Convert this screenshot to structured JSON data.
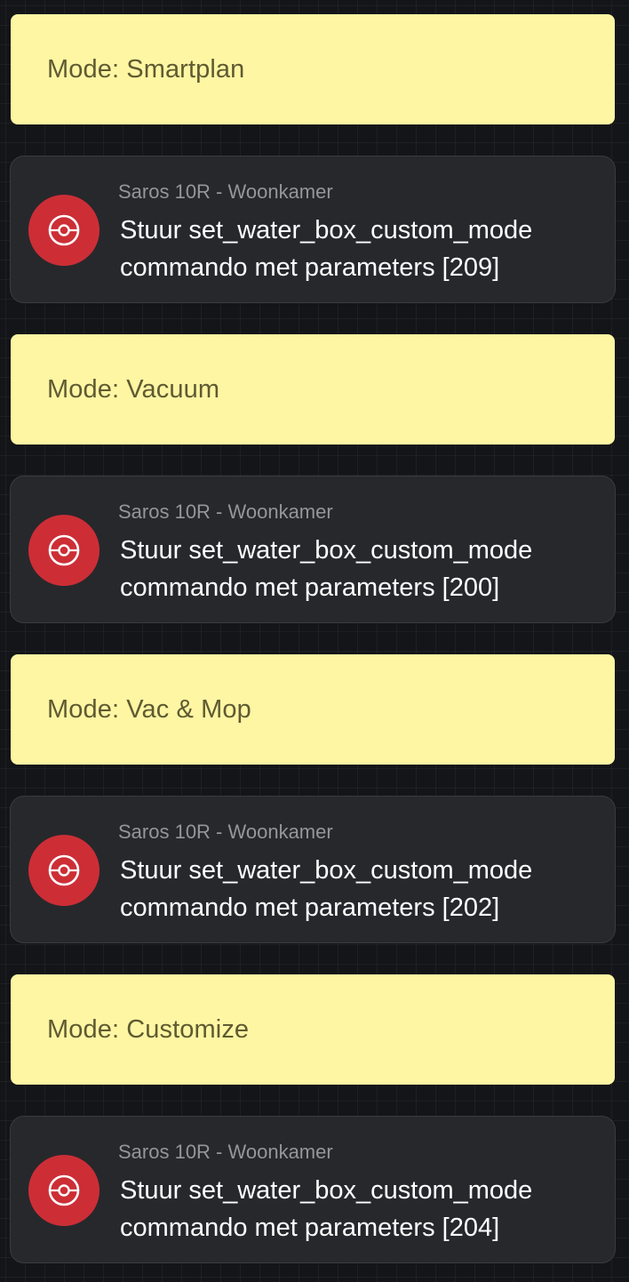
{
  "blocks": [
    {
      "note": {
        "text": "Mode: Smartplan"
      },
      "action": {
        "device": "Saros 10R - Woonkamer",
        "verb": "Stuur",
        "command": "set_water_box_custom_mode",
        "suffix": "commando met parameters",
        "params": "[209]",
        "icon": "robot-vacuum-icon"
      }
    },
    {
      "note": {
        "text": "Mode: Vacuum"
      },
      "action": {
        "device": "Saros 10R - Woonkamer",
        "verb": "Stuur",
        "command": "set_water_box_custom_mode",
        "suffix": "commando met parameters",
        "params": "[200]",
        "icon": "robot-vacuum-icon"
      }
    },
    {
      "note": {
        "text": "Mode: Vac & Mop"
      },
      "action": {
        "device": "Saros 10R - Woonkamer",
        "verb": "Stuur",
        "command": "set_water_box_custom_mode",
        "suffix": "commando met parameters",
        "params": "[202]",
        "icon": "robot-vacuum-icon"
      }
    },
    {
      "note": {
        "text": "Mode: Customize"
      },
      "action": {
        "device": "Saros 10R - Woonkamer",
        "verb": "Stuur",
        "command": "set_water_box_custom_mode",
        "suffix": "commando met parameters",
        "params": "[204]",
        "icon": "robot-vacuum-icon"
      }
    }
  ],
  "colors": {
    "background": "#141518",
    "note_bg": "#fef6a3",
    "note_text": "#5f5a32",
    "card_bg": "#27282c",
    "icon_bg": "#cd2e36",
    "subtitle": "#94969c"
  }
}
